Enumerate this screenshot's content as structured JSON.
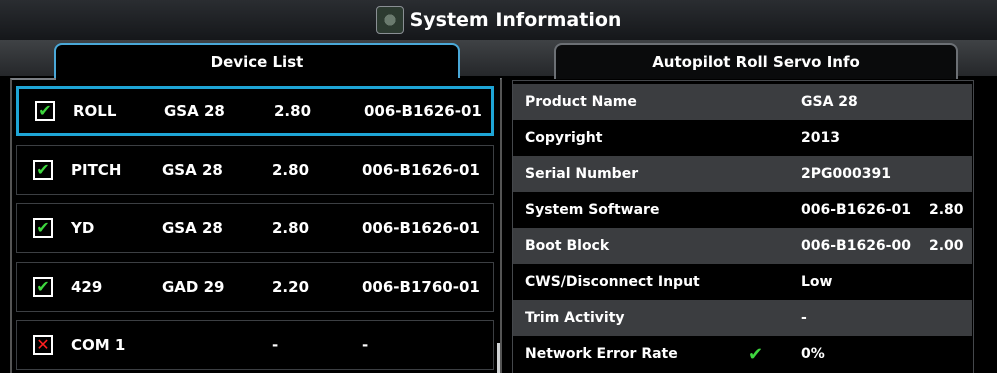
{
  "title": "System Information",
  "tabs": [
    {
      "label": "Device List",
      "active": true
    },
    {
      "label": "Autopilot Roll Servo Info",
      "active": false
    }
  ],
  "devices": [
    {
      "status": "ok",
      "name": "ROLL",
      "type": "GSA 28",
      "version": "2.80",
      "part": "006-B1626-01"
    },
    {
      "status": "ok",
      "name": "PITCH",
      "type": "GSA 28",
      "version": "2.80",
      "part": "006-B1626-01"
    },
    {
      "status": "ok",
      "name": "YD",
      "type": "GSA 28",
      "version": "2.80",
      "part": "006-B1626-01"
    },
    {
      "status": "ok",
      "name": "429",
      "type": "GAD 29",
      "version": "2.20",
      "part": "006-B1760-01"
    },
    {
      "status": "fail",
      "name": "COM 1",
      "type": "",
      "version": "-",
      "part": "-"
    }
  ],
  "info": [
    {
      "label": "Product Name",
      "value": "GSA 28",
      "ver": ""
    },
    {
      "label": "Copyright",
      "value": "2013",
      "ver": ""
    },
    {
      "label": "Serial Number",
      "value": "2PG000391",
      "ver": ""
    },
    {
      "label": "System Software",
      "value": "006-B1626-01",
      "ver": "2.80"
    },
    {
      "label": "Boot Block",
      "value": "006-B1626-00",
      "ver": "2.00"
    },
    {
      "label": "CWS/Disconnect Input",
      "value": "Low",
      "ver": ""
    },
    {
      "label": "Trim Activity",
      "value": "-",
      "ver": ""
    },
    {
      "label": "Network Error Rate",
      "value": "0%",
      "ver": ""
    }
  ],
  "icons": {
    "check": "check-icon",
    "cross": "x-icon",
    "app": "system-info-icon"
  },
  "colors": {
    "selected_border": "#1ea5d6",
    "ok_green": "#3ed63e",
    "fail_red": "#ff2020",
    "row_shade": "#3b3d40"
  }
}
